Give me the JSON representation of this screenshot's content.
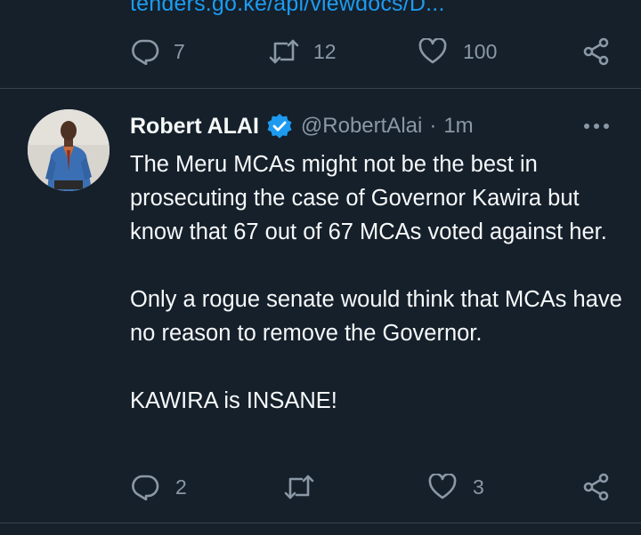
{
  "previous_tweet": {
    "link_text": "tenders.go.ke/api/viewdocs/D...",
    "actions": {
      "replies": "7",
      "retweets": "12",
      "likes": "100"
    }
  },
  "tweet": {
    "display_name": "Robert ALAI",
    "verified": true,
    "handle": "@RobertAlai",
    "separator": "·",
    "time": "1m",
    "paragraphs": [
      "The Meru MCAs might not be the best in prosecuting the case of Governor Kawira but know that 67 out of 67 MCAs voted against her.",
      "Only a rogue senate would think that MCAs have no reason to remove the Governor.",
      "KAWIRA is INSANE!"
    ],
    "actions": {
      "replies": "2",
      "retweets": "",
      "likes": "3"
    }
  },
  "icons": {
    "reply": "reply-icon",
    "retweet": "retweet-icon",
    "like": "heart-icon",
    "share": "share-icon",
    "more": "more-icon",
    "verified": "verified-badge-icon"
  },
  "colors": {
    "background": "#15202b",
    "text": "#f7f9f9",
    "secondary": "#8b98a5",
    "link": "#1d9bf0",
    "verified": "#1d9bf0",
    "divider": "#38444d"
  }
}
